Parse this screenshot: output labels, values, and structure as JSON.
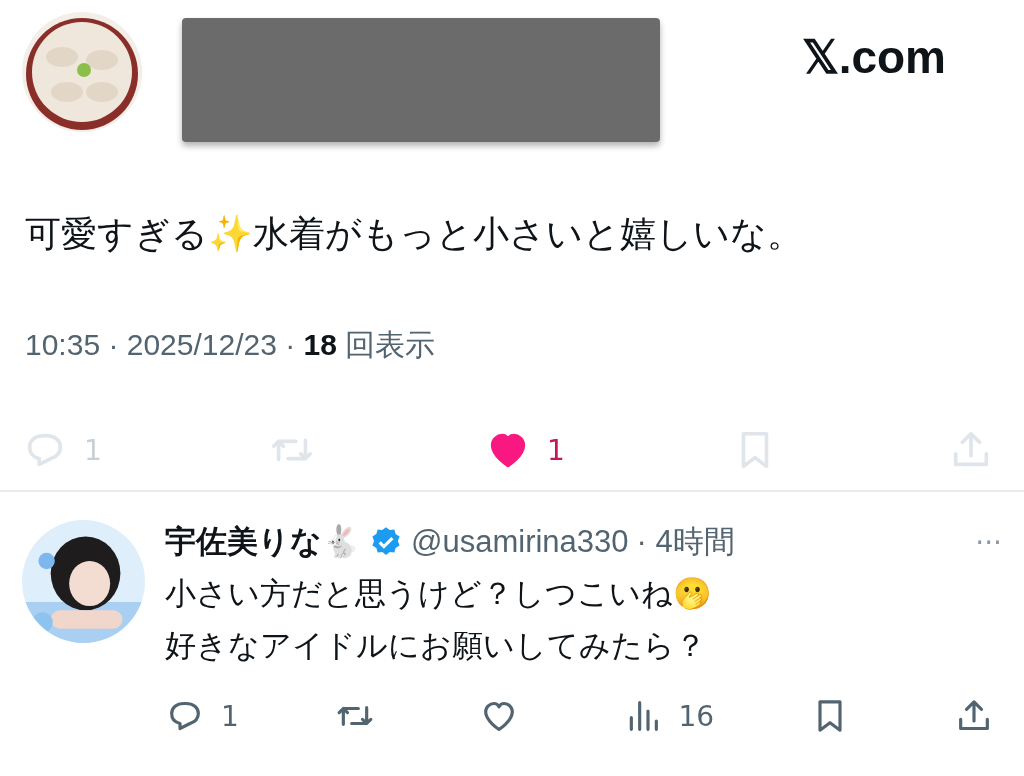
{
  "post": {
    "author": {
      "redacted": true
    },
    "brand": "𝕏.com",
    "text": "可愛すぎる✨水着がもっと小さいと嬉しいな。",
    "meta": {
      "time": "10:35 · 2025/12/23 · ",
      "views": "18",
      "views_label": "回表示"
    },
    "actions": {
      "dimmed": true,
      "items": [
        {
          "kind": "reply",
          "count": "1",
          "liked": false
        },
        {
          "kind": "repost",
          "liked": false
        },
        {
          "kind": "like",
          "count": "1",
          "liked": true
        },
        {
          "kind": "bookmark",
          "liked": false
        },
        {
          "kind": "share",
          "liked": false
        }
      ]
    }
  },
  "reply": {
    "author": {
      "name": "宇佐美りな🐇",
      "verified": true,
      "handle": "@usamirina330",
      "time": "· 4時間"
    },
    "more": "···",
    "lines": [
      "小さい方だと思うけど？しつこいね🫢",
      "好きなアイドルにお願いしてみたら？"
    ],
    "actions": {
      "dimmed": false,
      "items": [
        {
          "kind": "reply",
          "count": "1",
          "liked": false
        },
        {
          "kind": "repost",
          "liked": false
        },
        {
          "kind": "like",
          "liked": false
        },
        {
          "kind": "views",
          "count": "16",
          "liked": false
        },
        {
          "kind": "bookmark",
          "liked": false
        },
        {
          "kind": "share",
          "liked": false
        }
      ]
    }
  }
}
